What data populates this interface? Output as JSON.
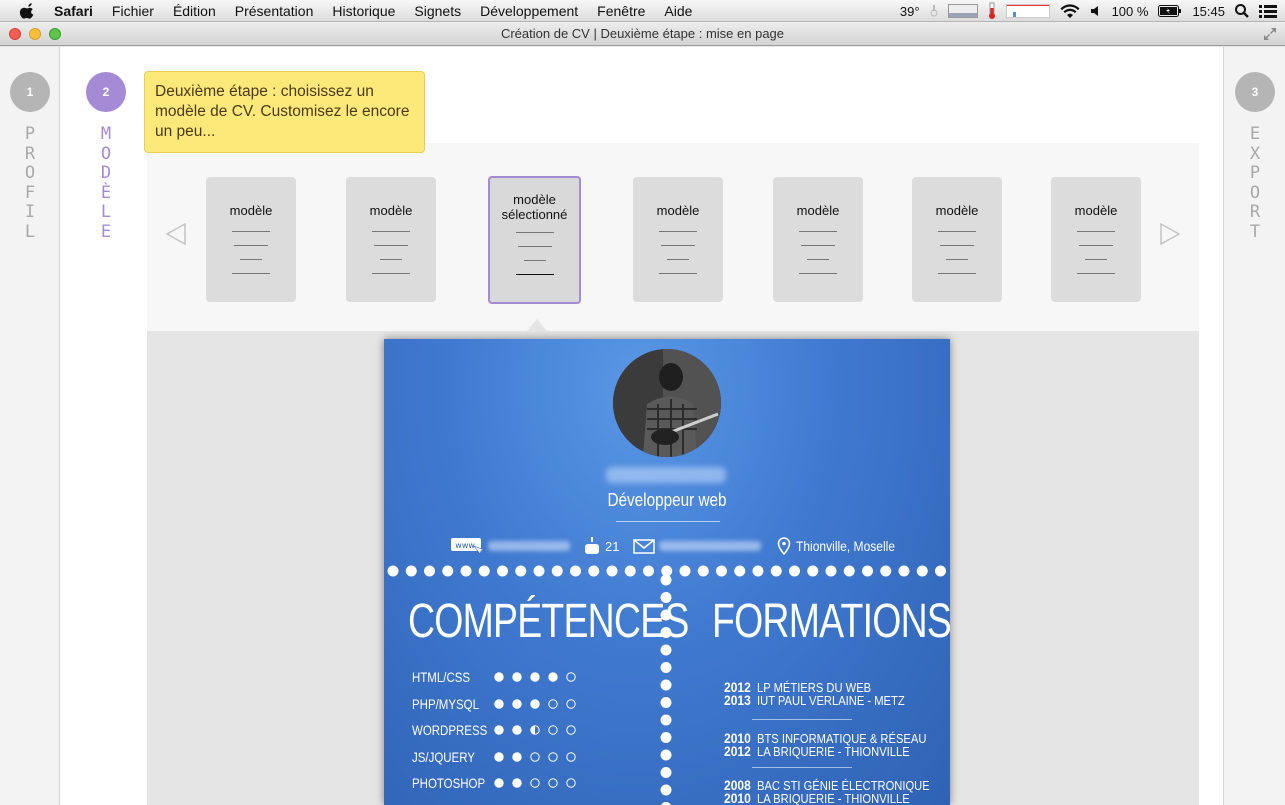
{
  "menubar": {
    "items": [
      "Safari",
      "Fichier",
      "Édition",
      "Présentation",
      "Historique",
      "Signets",
      "Développement",
      "Fenêtre",
      "Aide"
    ],
    "temperature": "39°",
    "battery": "100 %",
    "time": "15:45"
  },
  "window": {
    "title": "Création de CV | Deuxième étape : mise en page"
  },
  "steps": [
    {
      "number": "1",
      "label": "PROFIL"
    },
    {
      "number": "2",
      "label": "MODÈLE"
    },
    {
      "number": "3",
      "label": "EXPORT"
    }
  ],
  "tooltip": {
    "text": "Deuxième étape : choisissez un modèle de CV. Customisez le encore un peu..."
  },
  "templates": [
    {
      "label": "modèle"
    },
    {
      "label": "modèle"
    },
    {
      "label": "modèle sélectionné"
    },
    {
      "label": "modèle"
    },
    {
      "label": "modèle"
    },
    {
      "label": "modèle"
    },
    {
      "label": "modèle"
    }
  ],
  "cv": {
    "job_title": "Développeur web",
    "contact": {
      "www_icon_text": "www.",
      "age": "21",
      "location": "Thionville, Moselle"
    },
    "competences_title": "COMPÉTENCES",
    "formations_title": "FORMATIONS",
    "skills": [
      {
        "name": "HTML/CSS",
        "rating": 4
      },
      {
        "name": "PHP/MYSQL",
        "rating": 3
      },
      {
        "name": "WORDPRESS",
        "rating": 2.5
      },
      {
        "name": "JS/JQUERY",
        "rating": 2
      },
      {
        "name": "PHOTOSHOP",
        "rating": 2
      }
    ],
    "formations": [
      {
        "years": [
          "2012",
          "2013"
        ],
        "lines": [
          "LP MÉTIERS DU WEB",
          "IUT PAUL VERLAINE - METZ"
        ]
      },
      {
        "years": [
          "2010",
          "2012"
        ],
        "lines": [
          "BTS INFORMATIQUE & RÉSEAU",
          "LA BRIQUERIE - THIONVILLE"
        ]
      },
      {
        "years": [
          "2008",
          "2010"
        ],
        "lines": [
          "BAC STI GÉNIE ÉLECTRONIQUE",
          "LA BRIQUERIE - THIONVILLE"
        ]
      }
    ]
  },
  "colors": {
    "step_inactive": "#b5b5b5",
    "step_active": "#a58bd6",
    "tooltip_bg": "#fde97a",
    "cv_blue": "#3f79cf"
  }
}
